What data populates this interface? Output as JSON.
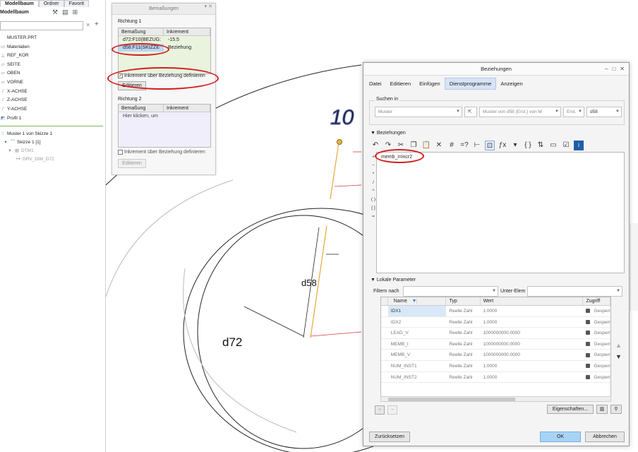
{
  "tree": {
    "tabs": [
      "Modellbaum",
      "Ordner",
      "Favorit"
    ],
    "title": "Modellbaum",
    "items": [
      {
        "label": "MUSTER.PRT",
        "icon": "part-icon"
      },
      {
        "label": "Materialien",
        "icon": "material-icon"
      },
      {
        "label": "REF_KOR",
        "icon": "csys-icon"
      },
      {
        "label": "SEITE",
        "icon": "plane-icon"
      },
      {
        "label": "OBEN",
        "icon": "plane-icon"
      },
      {
        "label": "VORNE",
        "icon": "plane-icon"
      },
      {
        "label": "X-ACHSE",
        "icon": "axis-icon"
      },
      {
        "label": "Z-ACHSE",
        "icon": "axis-icon"
      },
      {
        "label": "Y-ACHSE",
        "icon": "axis-icon"
      },
      {
        "label": "Profil 1",
        "icon": "profile-icon"
      }
    ],
    "pattern_items": [
      {
        "label": "Muster 1 von Skizze 1",
        "icon": "pattern-icon"
      },
      {
        "label": "Skizze 1 [1]",
        "icon": "sketch-icon"
      },
      {
        "label": "DTM1",
        "icon": "datum-icon"
      },
      {
        "label": "DRV_DIM_D72",
        "icon": "dim-icon"
      }
    ]
  },
  "canvas": {
    "dims": [
      "d58",
      "d72"
    ],
    "top_value": "10"
  },
  "bemassungen": {
    "title": "Bemaßungen",
    "richtung1": "Richtung 1",
    "richtung2": "Richtung 2",
    "col_bem": "Bemaßung",
    "col_inc": "Inkrement",
    "rows1": [
      {
        "bem": "d72:F10(BEZUG:",
        "inc": "-15.5"
      },
      {
        "bem": "d58:F11(SKIZZE",
        "inc": "Beziehung"
      }
    ],
    "rows2_placeholder": "Hier klicken, um",
    "check1": "Inkrement über Beziehung definieren",
    "check2": "Inkrement über Beziehung definieren",
    "edit1": "Editieren",
    "edit2": "Editieren"
  },
  "dialog": {
    "title": "Beziehungen",
    "menu": [
      "Datei",
      "Editieren",
      "Einfügen",
      "Dienstprogramme",
      "Anzeigen"
    ],
    "suchen_in": "Suchen in",
    "search_selects": [
      "Muster",
      "Muster von d58 (Erst.) von M",
      "Erst.",
      "d58"
    ],
    "beziehungen_label": "Beziehungen",
    "relation_text": "memb_i=incr2",
    "side_symbols": [
      "+",
      "−",
      "*",
      "/",
      "^",
      "( )",
      "[ ]",
      "="
    ],
    "lokale_label": "Lokale Parameter",
    "filter_label": "Filtern nach",
    "unter_label": "Unter-Elem",
    "param_headers": [
      "Name",
      "Typ",
      "Wert",
      "Zugriff"
    ],
    "params": [
      {
        "name": "IDX1",
        "typ": "Reelle Zahl",
        "wert": "1.0000",
        "zugriff": "Gesperr"
      },
      {
        "name": "IDX2",
        "typ": "Reelle Zahl",
        "wert": "1.0000",
        "zugriff": "Gesperr"
      },
      {
        "name": "LEAD_V",
        "typ": "Reelle Zahl",
        "wert": "1000000000.0000",
        "zugriff": "Gesperr"
      },
      {
        "name": "MEMB_I",
        "typ": "Reelle Zahl",
        "wert": "1000000000.0000",
        "zugriff": "Gesperr"
      },
      {
        "name": "MEMB_V",
        "typ": "Reelle Zahl",
        "wert": "1000000000.0000",
        "zugriff": "Gesperr"
      },
      {
        "name": "NUM_INST1",
        "typ": "Reelle Zahl",
        "wert": "1.0000",
        "zugriff": "Gesperr"
      },
      {
        "name": "NUM_INST2",
        "typ": "Reelle Zahl",
        "wert": "1.0000",
        "zugriff": "Gesperr"
      }
    ],
    "eigenschaften": "Eigenschaften...",
    "zuruecksetzen": "Zurücksetzen",
    "ok": "OK",
    "abbrechen": "Abbrechen"
  },
  "colors": {
    "accent": "#d21e1e",
    "ok": "#a9d3f5",
    "highlight": "#d9e8f8"
  }
}
